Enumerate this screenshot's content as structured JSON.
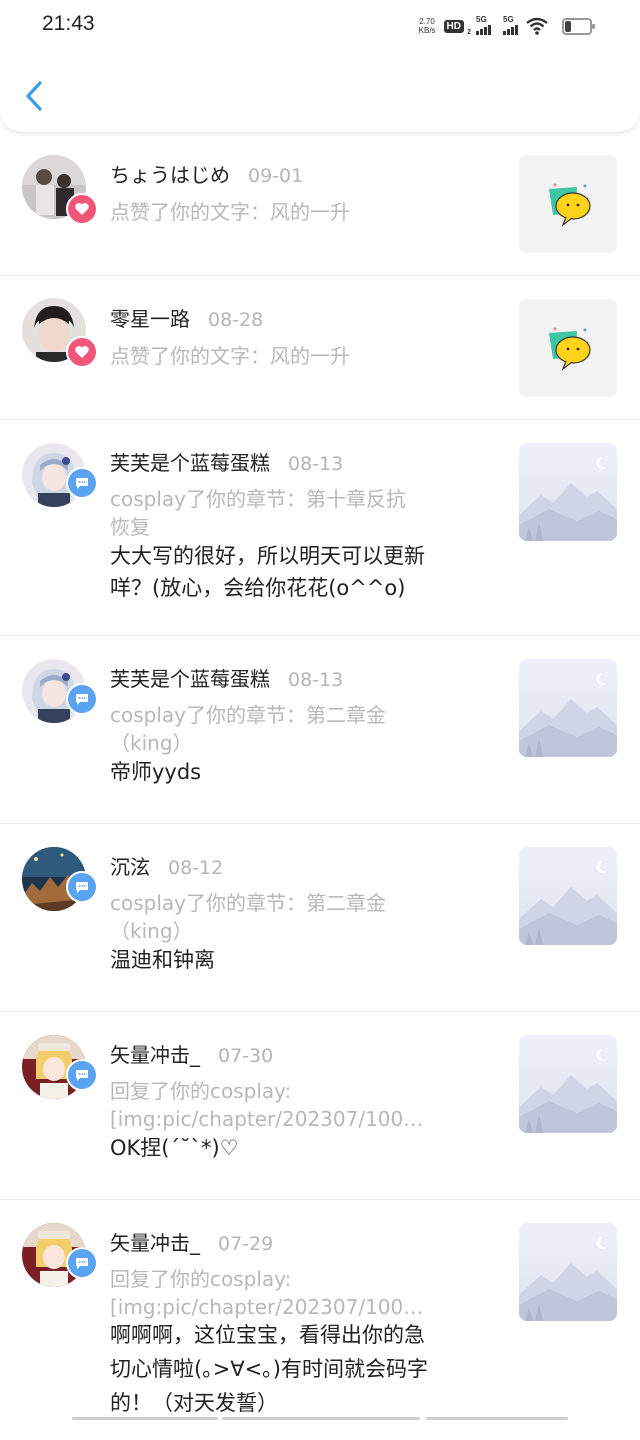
{
  "status": {
    "time": "21:43",
    "net_speed_value": "2.70",
    "net_speed_unit": "KB/s",
    "hd_label": "HD",
    "hd_sub": "2",
    "sig1_label": "5G",
    "sig2_label": "5G"
  },
  "header": {
    "back_icon": "chevron-left-icon",
    "accent": "#3a9be8"
  },
  "notifications": [
    {
      "name": "ちょうはじめ",
      "date": "09-01",
      "action": "点赞了你的文字：风的一升",
      "content": "",
      "type": "like",
      "thumb": "sticker"
    },
    {
      "name": "零星一路",
      "date": "08-28",
      "action": "点赞了你的文字：风的一升",
      "content": "",
      "type": "like",
      "thumb": "sticker"
    },
    {
      "name": "芙芙是个蓝莓蛋糕",
      "date": "08-13",
      "action_line1": "cosplay了你的章节：第十章反抗",
      "action_line2": "恢复",
      "content_line1": "大大写的很好，所以明天可以更新",
      "content_line2": "咩？(放心，会给你花花(o^^o)",
      "type": "comment",
      "thumb": "placeholder"
    },
    {
      "name": "芙芙是个蓝莓蛋糕",
      "date": "08-13",
      "action_line1": "cosplay了你的章节：第二章金",
      "action_line2": "（king）",
      "content": "帝师yyds",
      "type": "comment",
      "thumb": "placeholder"
    },
    {
      "name": "沉泫",
      "date": "08-12",
      "action_line1": "cosplay了你的章节：第二章金",
      "action_line2": "（king）",
      "content": "温迪和钟离",
      "type": "comment",
      "thumb": "placeholder"
    },
    {
      "name": "矢量冲击_",
      "date": "07-30",
      "action_line1": "回复了你的cosplay:",
      "action_line2": "[img:pic/chapter/202307/100…",
      "content": "OK捏(´˘`*)♡",
      "type": "comment",
      "thumb": "placeholder"
    },
    {
      "name": "矢量冲击_",
      "date": "07-29",
      "action_line1": "回复了你的cosplay:",
      "action_line2": "[img:pic/chapter/202307/100…",
      "content_line1": "啊啊啊，这位宝宝，看得出你的急",
      "content_line2": "切心情啦(｡>∀<｡)有时间就会码字",
      "content_line3": "的！（对天发誓）",
      "type": "comment",
      "thumb": "placeholder"
    }
  ],
  "colors": {
    "like_badge": "#f2557a",
    "comment_badge": "#5aa3f0",
    "date_gray": "#b5b5b5",
    "action_gray": "#b8b8b8"
  }
}
